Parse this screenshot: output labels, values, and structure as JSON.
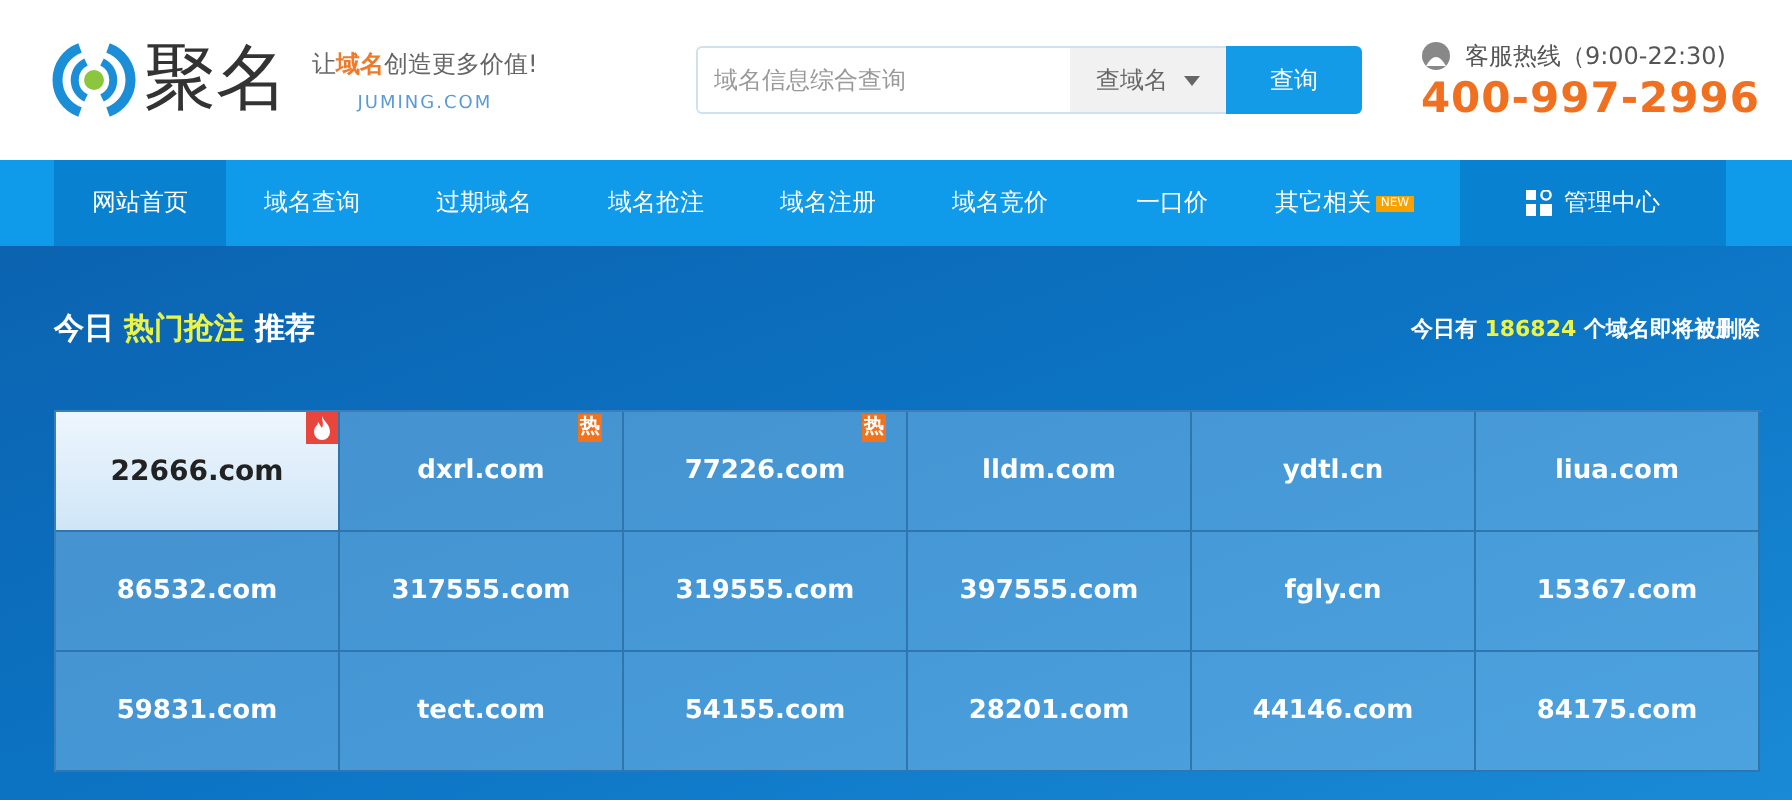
{
  "header": {
    "logo_text": "聚名",
    "slogan": "让**域名**创造更多价值!",
    "site": "JUMING.COM",
    "search": {
      "placeholder": "域名信息综合查询",
      "type_select": "查域名",
      "button": "查询"
    },
    "hotline": {
      "label": "客服热线（9:00-22:30)",
      "phone": "400-997-2996"
    }
  },
  "nav": {
    "items": [
      {
        "label": "网站首页",
        "selected": true
      },
      {
        "label": "域名查询",
        "selected": false
      },
      {
        "label": "过期域名",
        "selected": false
      },
      {
        "label": "域名抢注",
        "selected": false
      },
      {
        "label": "域名注册",
        "selected": false
      },
      {
        "label": "域名竞价",
        "selected": false
      },
      {
        "label": "一口价",
        "selected": false
      },
      {
        "label": "其它相关",
        "selected": false,
        "badge": "NEW"
      }
    ],
    "manage": "管理中心"
  },
  "hero": {
    "title": "今日 **热门抢注** 推荐",
    "stat": {
      "prefix": "今日有",
      "count": "186824",
      "suffix": "个域名即将被删除"
    },
    "domains": [
      {
        "name": "22666.com",
        "selected": true,
        "flame": true
      },
      {
        "name": "dxrl.com",
        "selected": false,
        "flame": false,
        "tag": "热"
      },
      {
        "name": "77226.com",
        "selected": false,
        "flame": false,
        "tag": "热"
      },
      {
        "name": "lldm.com",
        "selected": false,
        "flame": false
      },
      {
        "name": "ydtl.cn",
        "selected": false,
        "flame": false
      },
      {
        "name": "liua.com",
        "selected": false,
        "flame": false
      },
      {
        "name": "86532.com",
        "selected": false,
        "flame": false
      },
      {
        "name": "317555.com",
        "selected": false,
        "flame": false
      },
      {
        "name": "319555.com",
        "selected": false,
        "flame": false
      },
      {
        "name": "397555.com",
        "selected": false,
        "flame": false
      },
      {
        "name": "fgly.cn",
        "selected": false,
        "flame": false
      },
      {
        "name": "15367.com",
        "selected": false,
        "flame": false
      },
      {
        "name": "59831.com",
        "selected": false,
        "flame": false
      },
      {
        "name": "tect.com",
        "selected": false,
        "flame": false
      },
      {
        "name": "54155.com",
        "selected": false,
        "flame": false
      },
      {
        "name": "28201.com",
        "selected": false,
        "flame": false
      },
      {
        "name": "44146.com",
        "selected": false,
        "flame": false
      },
      {
        "name": "84175.com",
        "selected": false,
        "flame": false
      }
    ]
  }
}
